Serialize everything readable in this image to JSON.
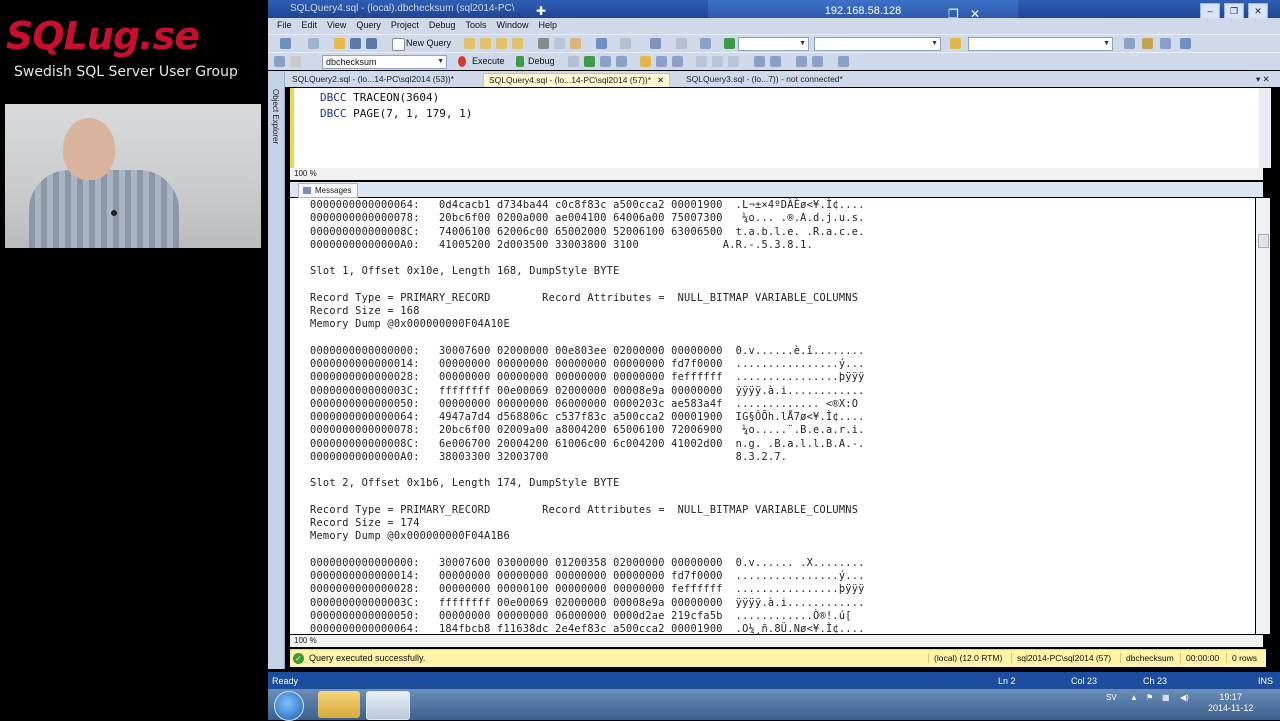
{
  "brand": {
    "logo": "SQLug.se",
    "subtitle": "Swedish SQL Server User Group"
  },
  "rdp_bar": {
    "window_title": "SQLQuery4.sql - (local).dbchecksum (sql2014-PC\\",
    "host": "192.168.58.128",
    "min_icon": "minimize-icon",
    "restore_icon": "restore-icon",
    "close_icon": "close-icon",
    "pin_icon": "pin-icon"
  },
  "menu": [
    "File",
    "Edit",
    "View",
    "Query",
    "Project",
    "Debug",
    "Tools",
    "Window",
    "Help"
  ],
  "toolbar1": {
    "new_query": "New Query"
  },
  "toolbar2": {
    "database": "dbchecksum",
    "execute": "Execute",
    "debug": "Debug"
  },
  "object_explorer": {
    "label": "Object Explorer"
  },
  "tabs": [
    {
      "label": "SQLQuery2.sql - (lo...14-PC\\sql2014 (53))*",
      "active": false
    },
    {
      "label": "SQLQuery4.sql - (lo...14-PC\\sql2014 (57))*",
      "active": true
    },
    {
      "label": "SQLQuery3.sql - (lo...7)) - not connected*",
      "active": false
    }
  ],
  "editor": {
    "line1_keyword": "DBCC",
    "line1_rest": " TRACEON(3604)",
    "line2_keyword": "DBCC",
    "line2_rest": " PAGE(7, 1, 179, 1)"
  },
  "zoom": {
    "editor": "100 %",
    "results": "100 %"
  },
  "results_tab": {
    "label": "Messages"
  },
  "results_text": "0000000000000064:   0d4cacb1 d734ba44 c0c8f83c a500cca2 00001900  .L¬±×4ºDÀÈø<¥.Ì¢....\n0000000000000078:   20bc6f00 0200a000 ae004100 64006a00 75007300   ¼o... .®.A.d.j.u.s.\n000000000000008C:   74006100 62006c00 65002000 52006100 63006500  t.a.b.l.e. .R.a.c.e.\n00000000000000A0:   41005200 2d003500 33003800 3100             A.R.-.5.3.8.1.\n\nSlot 1, Offset 0x10e, Length 168, DumpStyle BYTE\n\nRecord Type = PRIMARY_RECORD        Record Attributes =  NULL_BITMAP VARIABLE_COLUMNS\nRecord Size = 168\nMemory Dump @0x000000000F04A10E\n\n0000000000000000:   30007600 02000000 00e803ee 02000000 00000000  0.v......è.î........\n0000000000000014:   00000000 00000000 00000000 00000000 fd7f0000  ................ý...\n0000000000000028:   00000000 00000000 00000000 00000000 feffffff  ................þÿÿÿ\n000000000000003C:   ffffffff 00e00069 02000000 00008e9a 00000000  ÿÿÿÿ.à.i............\n0000000000000050:   00000000 00000000 06000000 0000203c ae583a4f  ............. <®X:O\n0000000000000064:   4947a7d4 d568806c c537f83c a500cca2 00001900  IG§ÔÕh.lÅ7ø<¥.Ì¢....\n0000000000000078:   20bc6f00 02009a00 a8004200 65006100 72006900   ¼o.....¨.B.e.a.r.i.\n000000000000008C:   6e006700 20004200 61006c00 6c004200 41002d00  n.g. .B.a.l.l.B.A.-.\n00000000000000A0:   38003300 32003700                             8.3.2.7.\n\nSlot 2, Offset 0x1b6, Length 174, DumpStyle BYTE\n\nRecord Type = PRIMARY_RECORD        Record Attributes =  NULL_BITMAP VARIABLE_COLUMNS\nRecord Size = 174\nMemory Dump @0x000000000F04A1B6\n\n0000000000000000:   30007600 03000000 01200358 02000000 00000000  0.v...... .X........\n0000000000000014:   00000000 00000000 00000000 00000000 fd7f0000  ................ý...\n0000000000000028:   00000000 00000100 00000000 00000000 feffffff  ................þÿÿÿ\n000000000000003C:   ffffffff 00e00069 02000000 00008e9a 00000000  ÿÿÿÿ.à.i............\n0000000000000050:   00000000 00000000 06000000 0000d2ae 219cfa5b  ............Ò®!.ú[\n0000000000000064:   184fbcb8 f11638dc 2e4ef83c a500cca2 00001900  .O¼¸ñ.8Ü.Nø<¥.Ì¢....",
  "status": {
    "message": "Query executed successfully.",
    "server": "(local) (12.0 RTM)",
    "login": "sql2014-PC\\sql2014 (57)",
    "database": "dbchecksum",
    "elapsed": "00:00:00",
    "rows": "0 rows"
  },
  "app_status": {
    "ready": "Ready",
    "line": "Ln 2",
    "col": "Col 23",
    "ch": "Ch 23",
    "mode": "INS"
  },
  "taskbar": {
    "lang": "SV",
    "time": "19:17",
    "date": "2014-11-12"
  }
}
